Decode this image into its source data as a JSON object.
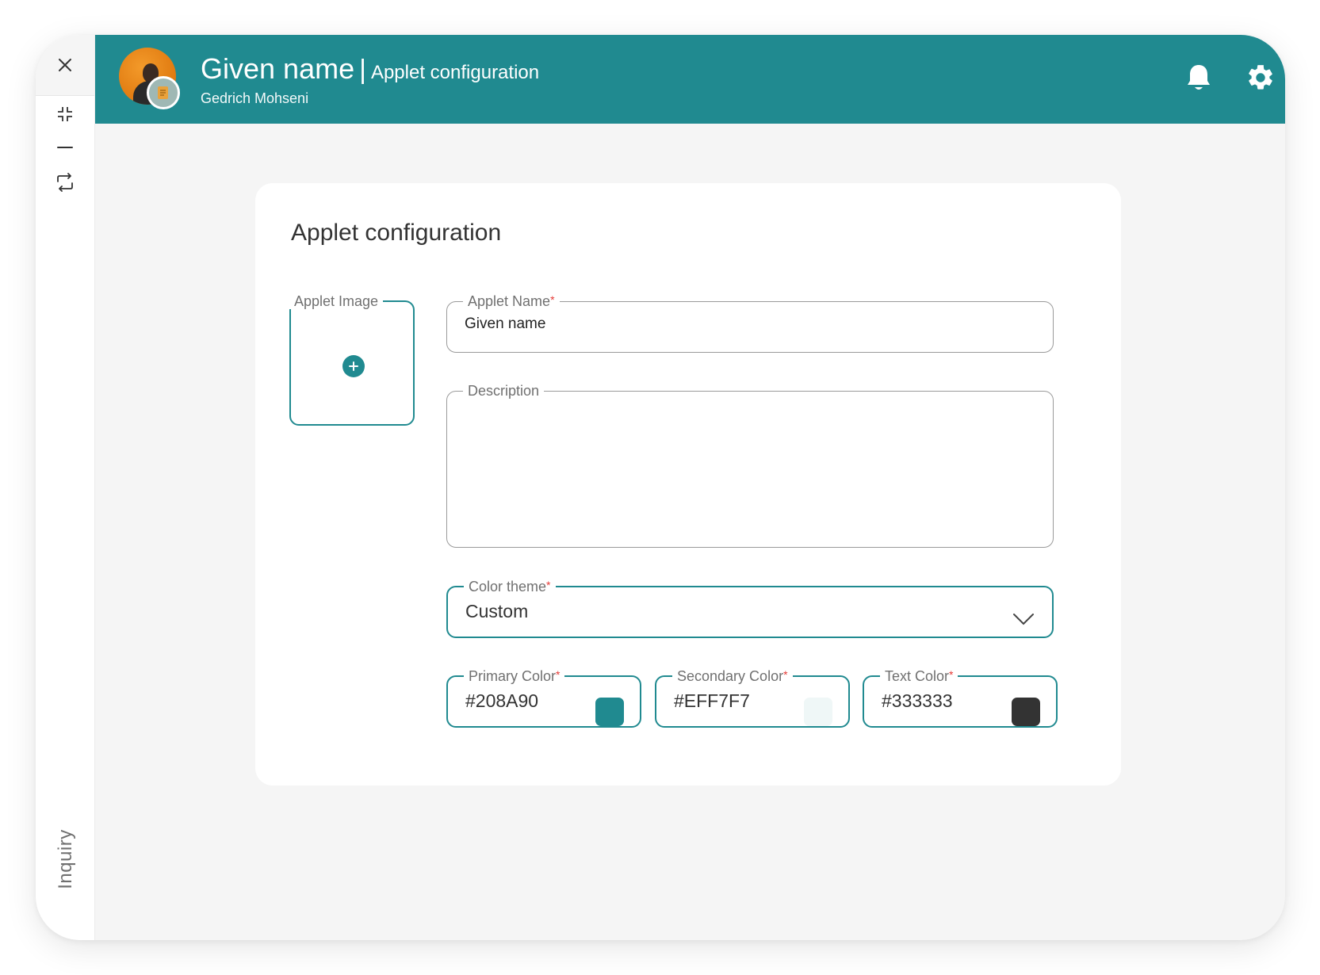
{
  "header": {
    "title": "Given name",
    "separator": "|",
    "subtitle": "Applet configuration",
    "user_name": "Gedrich Mohseni",
    "bell_icon": "bell-icon",
    "settings_icon": "gear-icon",
    "background_color": "#208A90"
  },
  "rail": {
    "close_icon": "close-icon",
    "collapse_icon": "collapse-icon",
    "minimize_icon": "minimize-icon",
    "switch_icon": "switch-icon",
    "vertical_label": "Inquiry"
  },
  "card": {
    "title": "Applet configuration",
    "applet_image": {
      "label": "Applet Image",
      "add_icon": "plus-circle-icon"
    },
    "applet_name": {
      "label": "Applet Name",
      "required": "*",
      "value": "Given name"
    },
    "description": {
      "label": "Description",
      "value": ""
    },
    "color_theme": {
      "label": "Color theme",
      "required": "*",
      "value": "Custom",
      "icon": "chevron-down-icon"
    },
    "primary_color": {
      "label": "Primary Color",
      "required": "*",
      "value": "#208A90",
      "swatch": "#208A90"
    },
    "secondary_color": {
      "label": "Secondary Color",
      "required": "*",
      "value": "#EFF7F7",
      "swatch": "#EFF7F7"
    },
    "text_color": {
      "label": "Text Color",
      "required": "*",
      "value": "#333333",
      "swatch": "#333333"
    }
  }
}
